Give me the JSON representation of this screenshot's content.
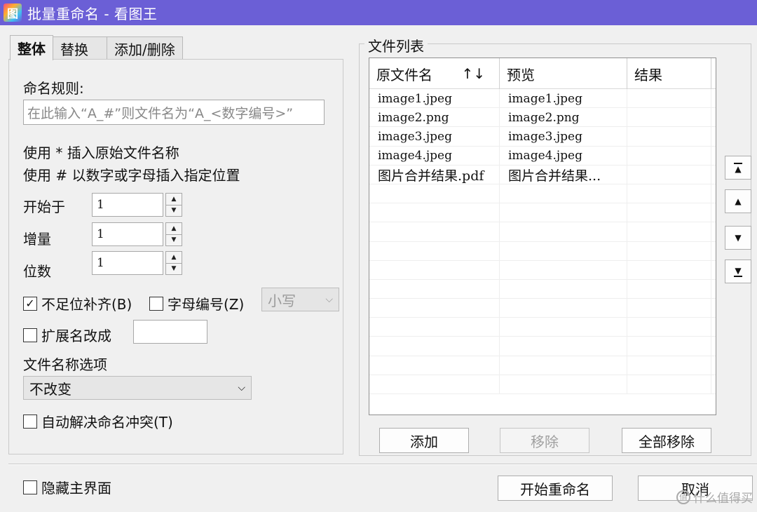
{
  "window": {
    "title": "批量重命名 - 看图王",
    "app_icon_glyph": "图"
  },
  "tabs": [
    {
      "label": "整体",
      "active": true
    },
    {
      "label": "替换",
      "active": false
    },
    {
      "label": "添加/删除",
      "active": false
    }
  ],
  "rules": {
    "label": "命名规则:",
    "placeholder": "在此输入“A_#”则文件名为“A_<数字编号>”",
    "hint1": "使用 * 插入原始文件名称",
    "hint2": "使用 # 以数字或字母插入指定位置"
  },
  "numbers": {
    "start_label": "开始于",
    "start_value": "1",
    "step_label": "增量",
    "step_value": "1",
    "digits_label": "位数",
    "digits_value": "1"
  },
  "options": {
    "pad_label": "不足位补齐(B)",
    "pad_checked": true,
    "pad_mark": "✓",
    "letter_label": "字母编号(Z)",
    "letter_checked": false,
    "case_select": "小写",
    "ext_label": "扩展名改成",
    "ext_checked": false,
    "name_opts_label": "文件名称选项",
    "name_opts_select": "不改变",
    "conflict_label": "自动解决命名冲突(T)",
    "conflict_checked": false
  },
  "filelist": {
    "title": "文件列表",
    "headers": {
      "original": "原文件名",
      "sort": "↑↓",
      "preview": "预览",
      "result": "结果"
    },
    "rows": [
      {
        "original": "image1.jpeg",
        "preview": "image1.jpeg",
        "result": ""
      },
      {
        "original": "image2.png",
        "preview": "image2.png",
        "result": ""
      },
      {
        "original": "image3.jpeg",
        "preview": "image3.jpeg",
        "result": ""
      },
      {
        "original": "image4.jpeg",
        "preview": "image4.jpeg",
        "result": ""
      },
      {
        "original": "图片合并结果.pdf",
        "preview": "图片合并结果...",
        "result": ""
      }
    ],
    "add_label": "添加",
    "remove_label": "移除",
    "remove_all_label": "全部移除"
  },
  "side_buttons": {
    "top": "▲",
    "up": "▲",
    "down": "▼",
    "bottom": "▼"
  },
  "footer": {
    "hide_main_label": "隐藏主界面",
    "hide_main_checked": false,
    "start_label": "开始重命名",
    "cancel_label": "取消"
  },
  "watermark": {
    "text": "什么值得买",
    "icon": "值"
  }
}
